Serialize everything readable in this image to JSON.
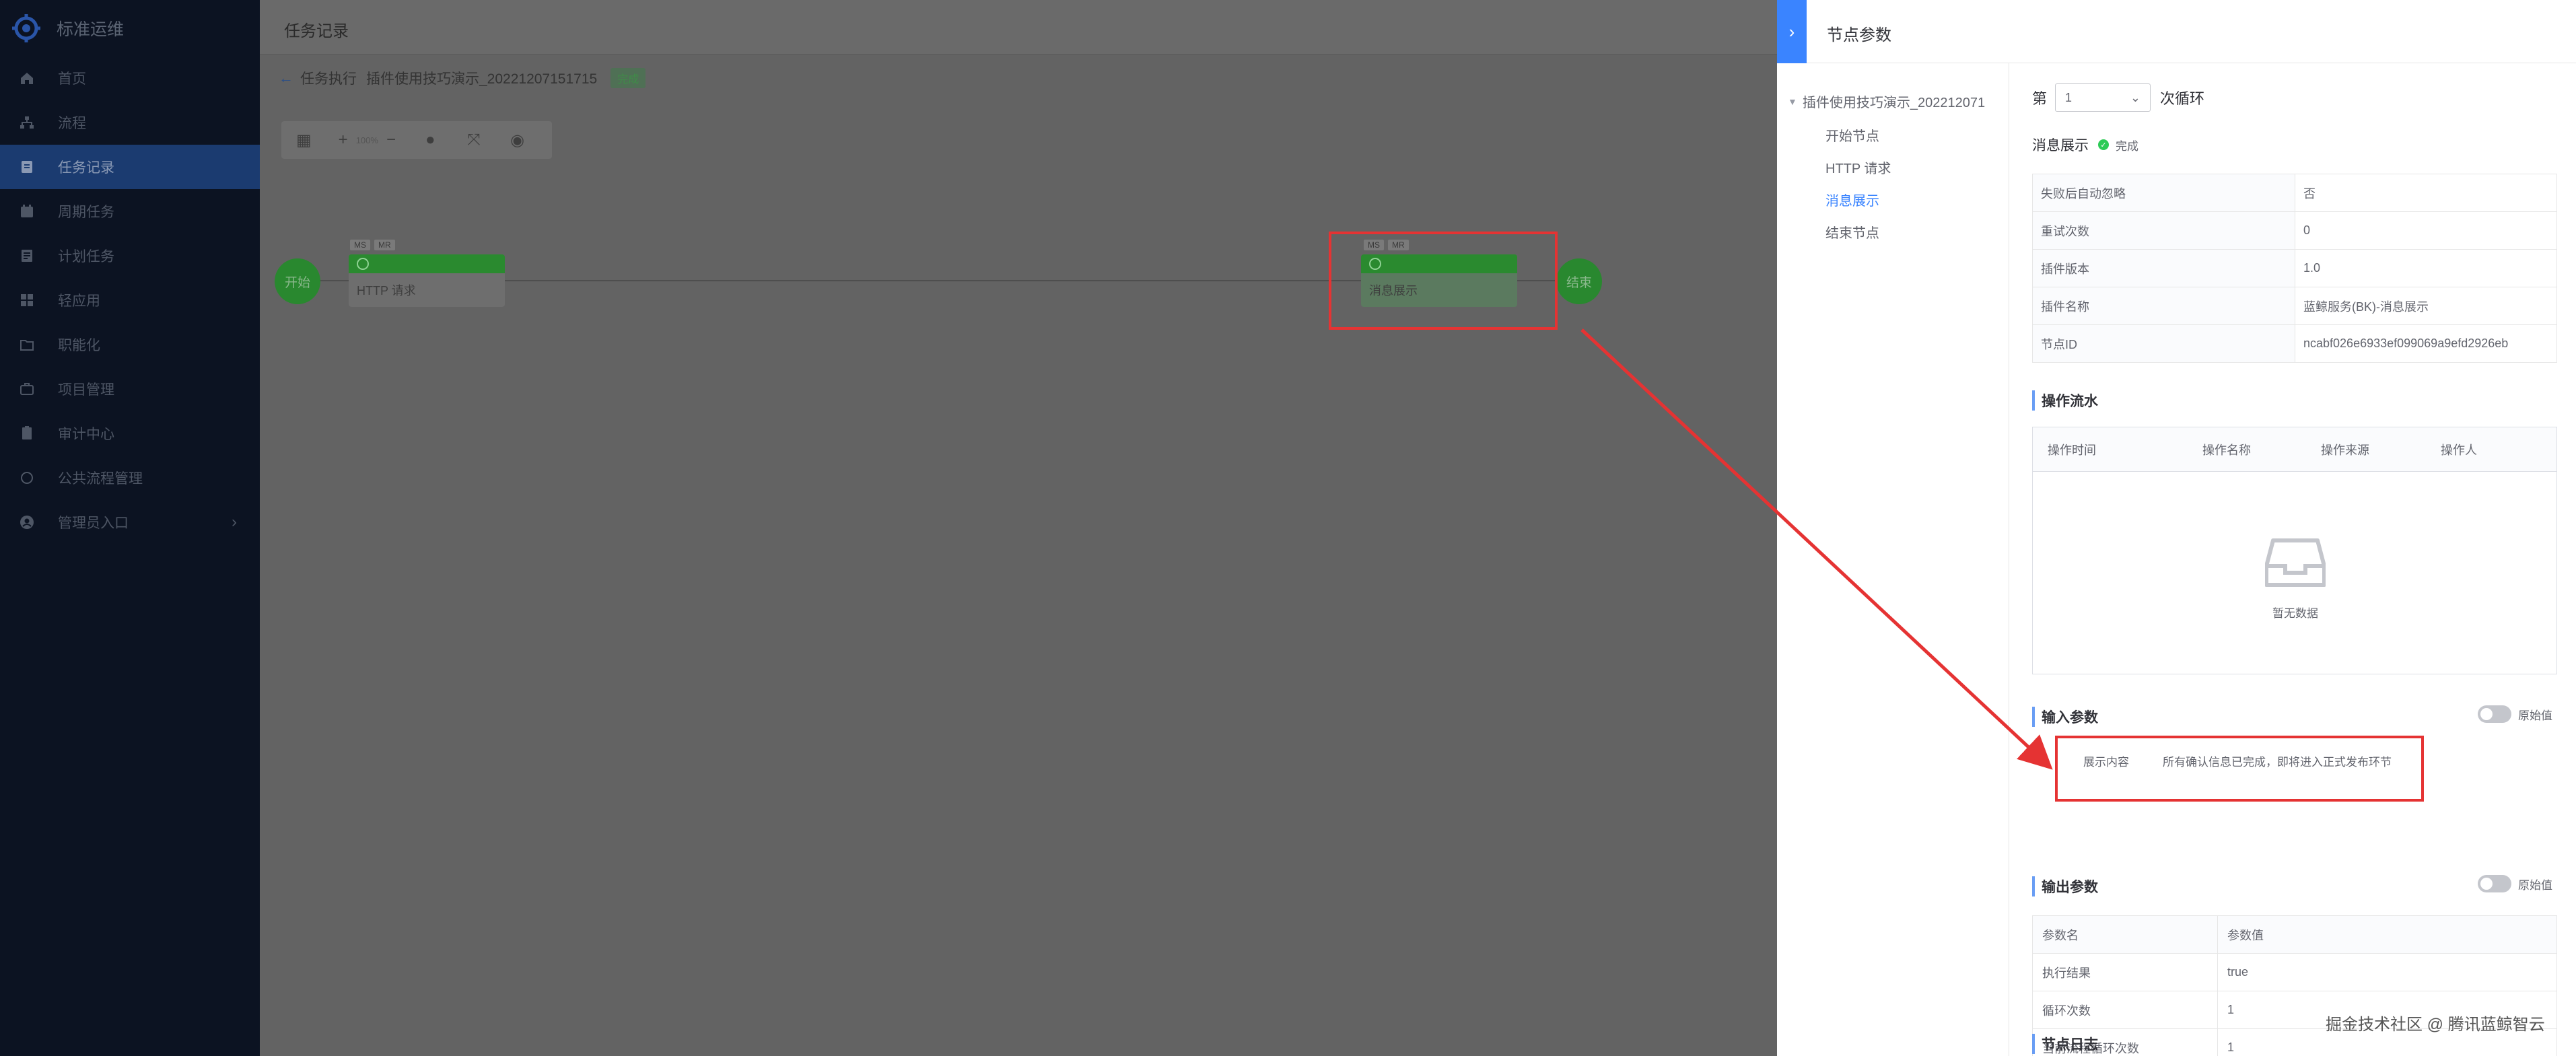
{
  "sidebar": {
    "brand": "标准运维",
    "items": [
      {
        "label": "首页",
        "icon": "home-icon"
      },
      {
        "label": "流程",
        "icon": "flow-icon"
      },
      {
        "label": "任务记录",
        "icon": "task-record-icon",
        "active": true
      },
      {
        "label": "周期任务",
        "icon": "periodic-task-icon"
      },
      {
        "label": "计划任务",
        "icon": "plan-task-icon"
      },
      {
        "label": "轻应用",
        "icon": "light-app-icon"
      },
      {
        "label": "职能化",
        "icon": "functional-icon"
      },
      {
        "label": "项目管理",
        "icon": "project-icon"
      },
      {
        "label": "审计中心",
        "icon": "audit-icon"
      },
      {
        "label": "公共流程管理",
        "icon": "public-flow-icon"
      },
      {
        "label": "管理员入口",
        "icon": "admin-icon",
        "has_arrow": true
      }
    ]
  },
  "main": {
    "title": "任务记录",
    "breadcrumb": {
      "parent": "任务执行",
      "task": "插件使用技巧演示_20221207151715",
      "status": "完成"
    },
    "toolbar": {
      "zoom": "100%"
    },
    "canvas": {
      "start": "开始",
      "end": "结束",
      "nodes": [
        {
          "label": "HTTP 请求",
          "tags": [
            "MS",
            "MR"
          ]
        },
        {
          "label": "消息展示",
          "tags": [
            "MS",
            "MR"
          ]
        }
      ]
    }
  },
  "panel": {
    "title": "节点参数",
    "tree": {
      "root": "插件使用技巧演示_202212071",
      "items": [
        "开始节点",
        "HTTP 请求",
        "消息展示",
        "结束节点"
      ],
      "active_index": 2
    },
    "loop": {
      "prefix": "第",
      "value": "1",
      "suffix": "次循环"
    },
    "node": {
      "name": "消息展示",
      "status": "完成"
    },
    "info_rows": [
      {
        "key": "失败后自动忽略",
        "value": "否"
      },
      {
        "key": "重试次数",
        "value": "0"
      },
      {
        "key": "插件版本",
        "value": "1.0"
      },
      {
        "key": "插件名称",
        "value": "蓝鲸服务(BK)-消息展示"
      },
      {
        "key": "节点ID",
        "value": "ncabf026e6933ef099069a9efd2926eb"
      }
    ],
    "operation_log": {
      "title": "操作流水",
      "columns": [
        "操作时间",
        "操作名称",
        "操作来源",
        "操作人"
      ],
      "empty_text": "暂无数据"
    },
    "input_params": {
      "title": "输入参数",
      "toggle_label": "原始值",
      "label": "展示内容",
      "value": "所有确认信息已完成，即将进入正式发布环节"
    },
    "output_params": {
      "title": "输出参数",
      "toggle_label": "原始值",
      "header": {
        "name": "参数名",
        "value": "参数值"
      },
      "rows": [
        {
          "name": "执行结果",
          "value": "true"
        },
        {
          "name": "循环次数",
          "value": "1"
        },
        {
          "name": "当前流程循环次数",
          "value": "1"
        }
      ]
    },
    "node_log": {
      "title": "节点日志"
    }
  },
  "watermark": "掘金技术社区 @ 腾讯蓝鲸智云",
  "colors": {
    "accent": "#3a84ff",
    "success": "#2dcb56",
    "highlight": "#e53333",
    "sidebar_bg": "#0c1322",
    "sidebar_active": "#1b3b70"
  }
}
